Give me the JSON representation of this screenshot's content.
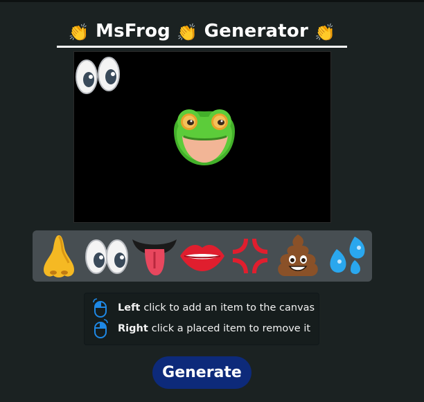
{
  "header": {
    "title_text": "MsFrog",
    "title_suffix": "Generator",
    "left_icon": "clapping-hands-icon",
    "mid_icon": "clapping-hands-icon",
    "right_icon": "clapping-hands-icon"
  },
  "canvas": {
    "background": "#000000",
    "placed_items": [
      "eyes-emoji",
      "frog-face"
    ]
  },
  "palette": {
    "items": [
      {
        "name": "nose-emoji"
      },
      {
        "name": "eyes-emoji"
      },
      {
        "name": "tongue-mouth-emoji"
      },
      {
        "name": "lips-emoji"
      },
      {
        "name": "anger-symbol-emoji"
      },
      {
        "name": "poop-emoji"
      },
      {
        "name": "sweat-droplets-emoji"
      }
    ]
  },
  "instructions": {
    "left_bold": "Left",
    "left_text": "click to add an item to the canvas",
    "right_bold": "Right",
    "right_text": "click a placed item to remove it",
    "left_icon": "left-mouse-button-icon",
    "right_icon": "right-mouse-button-icon"
  },
  "generate_button": {
    "label": "Generate"
  },
  "colors": {
    "page_background": "#1b2222",
    "palette_background": "#474e52",
    "button_background": "#0d2a7a",
    "mouse_icon_blue": "#1e88e5"
  }
}
